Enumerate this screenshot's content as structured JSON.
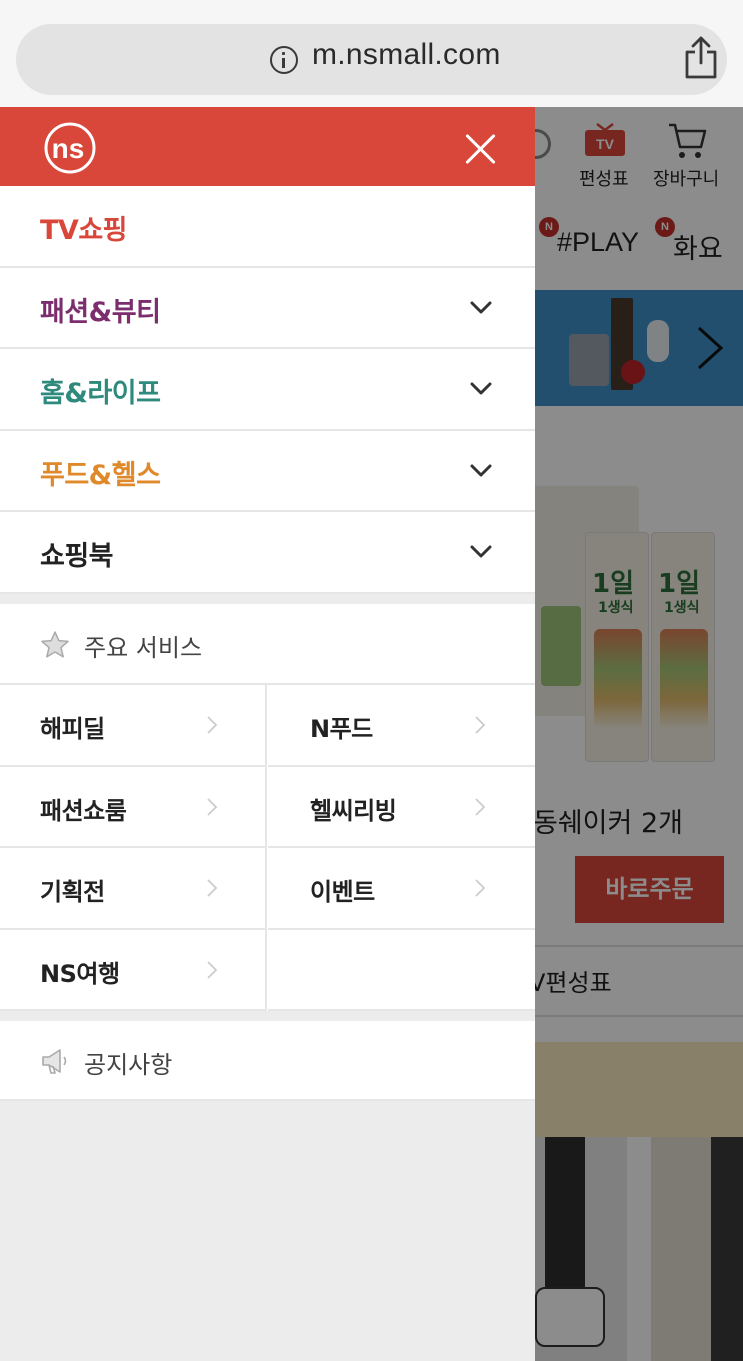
{
  "browser": {
    "url": "m.nsmall.com"
  },
  "background_page": {
    "header": {
      "tv_badge": "TV",
      "tv_label": "편성표",
      "cart_label": "장바구니"
    },
    "tabs": [
      {
        "badge": "N",
        "label": "#PLAY"
      },
      {
        "badge": "N",
        "label": "화요"
      }
    ],
    "product": {
      "pkg_text_big": "1일",
      "pkg_text_small": "1생식",
      "title": "동쉐이커 2개",
      "order_button": "바로주문"
    },
    "schedule_link": "V편성표"
  },
  "drawer": {
    "logo": "ns",
    "categories": [
      {
        "label": "TV쇼핑",
        "color": "#d9473a",
        "expandable": false
      },
      {
        "label": "패션&뷰티",
        "color": "#7b2d6e",
        "expandable": true
      },
      {
        "label": "홈&라이프",
        "color": "#2f8a7e",
        "expandable": true
      },
      {
        "label": "푸드&헬스",
        "color": "#e0892a",
        "expandable": true
      },
      {
        "label": "쇼핑북",
        "color": "#222222",
        "expandable": true
      }
    ],
    "services": {
      "title": "주요 서비스",
      "items": [
        {
          "label": "해피딜"
        },
        {
          "label": "N푸드"
        },
        {
          "label": "패션쇼룸"
        },
        {
          "label": "헬씨리빙"
        },
        {
          "label": "기획전"
        },
        {
          "label": "이벤트"
        },
        {
          "label": "NS여행"
        }
      ]
    },
    "notice": {
      "label": "공지사항"
    }
  },
  "colors": {
    "brand_red": "#d9473a",
    "drawer_bg": "#ececec"
  }
}
